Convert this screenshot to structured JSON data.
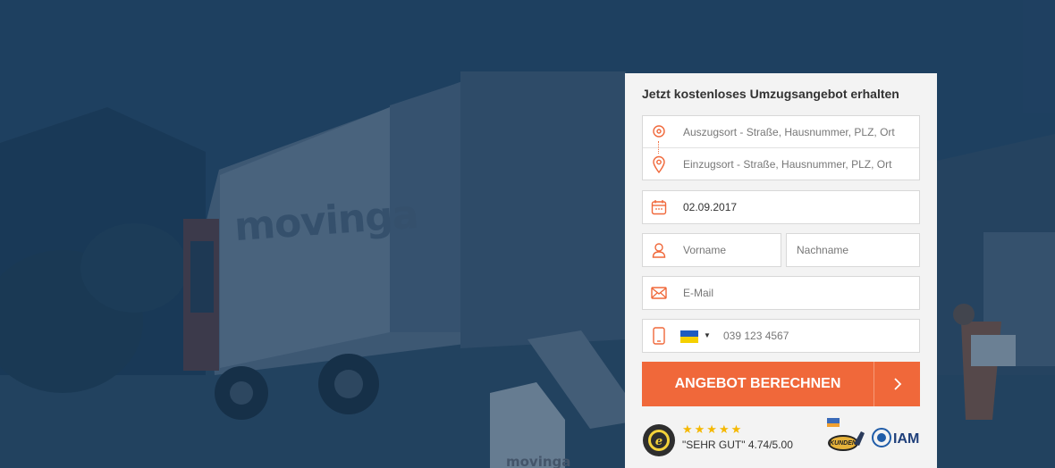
{
  "hero": {
    "truck_brand": "movinga",
    "box_brand": "movinga"
  },
  "form": {
    "title": "Jetzt kostenloses Umzugsangebot erhalten",
    "from_placeholder": "Auszugsort - Straße, Hausnummer, PLZ, Ort",
    "to_placeholder": "Einzugsort - Straße, Hausnummer, PLZ, Ort",
    "date_value": "02.09.2017",
    "firstname_placeholder": "Vorname",
    "lastname_placeholder": "Nachname",
    "email_placeholder": "E-Mail",
    "phone_placeholder": "039 123 4567",
    "phone_country_flag": "ukraine-flag",
    "submit_label": "ANGEBOT BERECHNEN"
  },
  "rating": {
    "stars": "★★★★★",
    "score": 4.74,
    "text": "\"SEHR GUT\" 4.74/5.00"
  },
  "badges": {
    "kunden": "KUNDEN",
    "iam": "IAM"
  },
  "colors": {
    "accent": "#f0683a",
    "overlay": "#143454",
    "card": "#f3f3f3"
  },
  "icons": [
    "location-pin-icon",
    "calendar-icon",
    "user-icon",
    "envelope-icon",
    "mobile-phone-icon",
    "chevron-right-icon"
  ]
}
